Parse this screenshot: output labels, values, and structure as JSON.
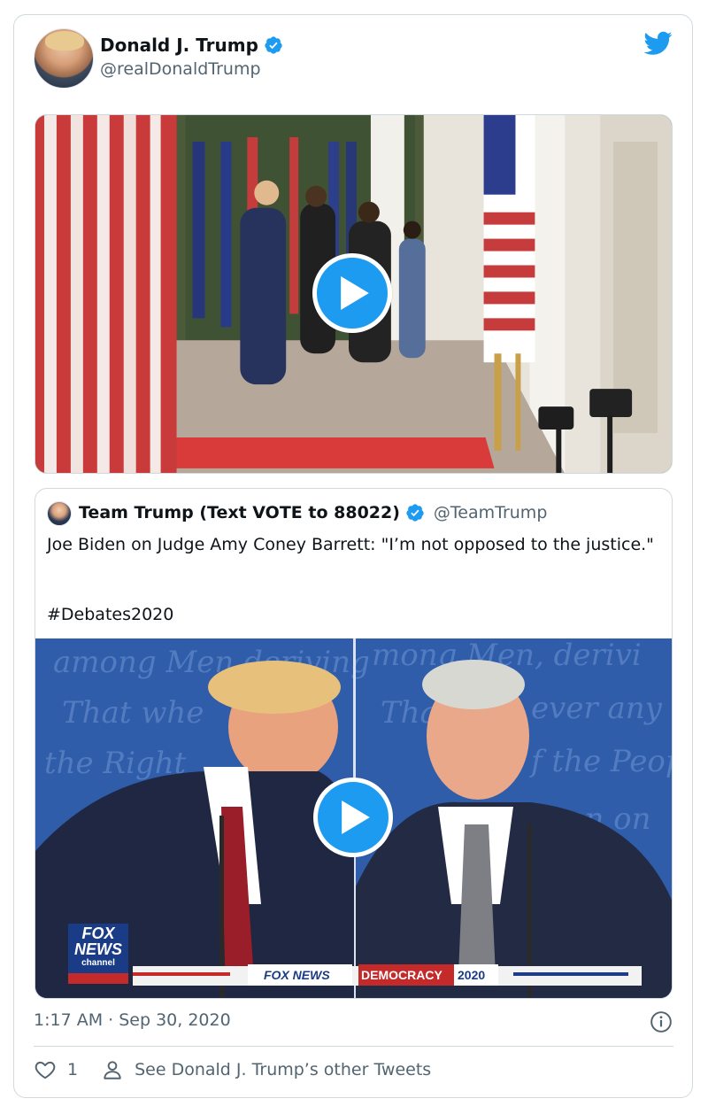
{
  "author": {
    "display_name": "Donald J. Trump",
    "handle": "@realDonaldTrump",
    "verified": true
  },
  "media": [
    {
      "type": "video",
      "icon": "play-icon"
    }
  ],
  "quoted_tweet": {
    "display_name": "Team Trump (Text VOTE to 88022)",
    "handle": "@TeamTrump",
    "verified": true,
    "text": "Joe Biden on Judge Amy Coney Barrett: \"I’m not opposed to the justice.\"",
    "hashtag": "#Debates2020",
    "media": {
      "type": "video",
      "icon": "play-icon"
    },
    "lower_third": {
      "network": "FOX NEWS",
      "logo_top": "FOX",
      "logo_mid": "NEWS",
      "logo_bottom": "channel",
      "banner": "DEMOCRACY",
      "year": "2020"
    }
  },
  "timestamp": "1:17 AM · Sep 30, 2020",
  "actions": {
    "like_count": "1",
    "see_more": "See Donald J. Trump’s other Tweets"
  },
  "colors": {
    "accent": "#1d9bf0",
    "text": "#0f1419",
    "secondary": "#536471",
    "border": "#cfd9de"
  }
}
